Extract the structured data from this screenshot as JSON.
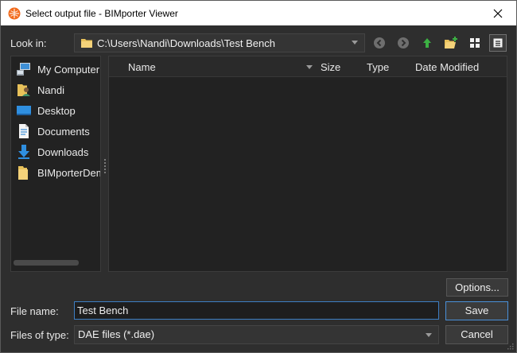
{
  "window": {
    "title": "Select output file - BIMporter Viewer",
    "accent_color": "#4a90d9",
    "background_color": "#2e2e2e"
  },
  "lookin": {
    "label": "Look in:",
    "path": "C:\\Users\\Nandi\\Downloads\\Test Bench"
  },
  "toolbar": {
    "back_icon": "back-arrow-icon",
    "forward_icon": "forward-arrow-icon",
    "up_icon": "parent-directory-icon",
    "new_folder_icon": "new-folder-icon",
    "list_view_icon": "list-view-icon",
    "detail_view_icon": "detail-view-icon"
  },
  "sidebar": {
    "items": [
      {
        "label": "My Computer",
        "icon": "computer-icon"
      },
      {
        "label": "Nandi",
        "icon": "user-folder-icon"
      },
      {
        "label": "Desktop",
        "icon": "desktop-icon"
      },
      {
        "label": "Documents",
        "icon": "documents-icon"
      },
      {
        "label": "Downloads",
        "icon": "downloads-icon"
      },
      {
        "label": "BIMporterDemo",
        "icon": "folder-icon"
      }
    ]
  },
  "filelist": {
    "columns": [
      "Name",
      "Size",
      "Type",
      "Date Modified"
    ],
    "rows": []
  },
  "buttons": {
    "options": "Options...",
    "save": "Save",
    "cancel": "Cancel"
  },
  "filename": {
    "label": "File name:",
    "value": "Test Bench"
  },
  "filetype": {
    "label": "Files of type:",
    "value": "DAE files (*.dae)"
  }
}
